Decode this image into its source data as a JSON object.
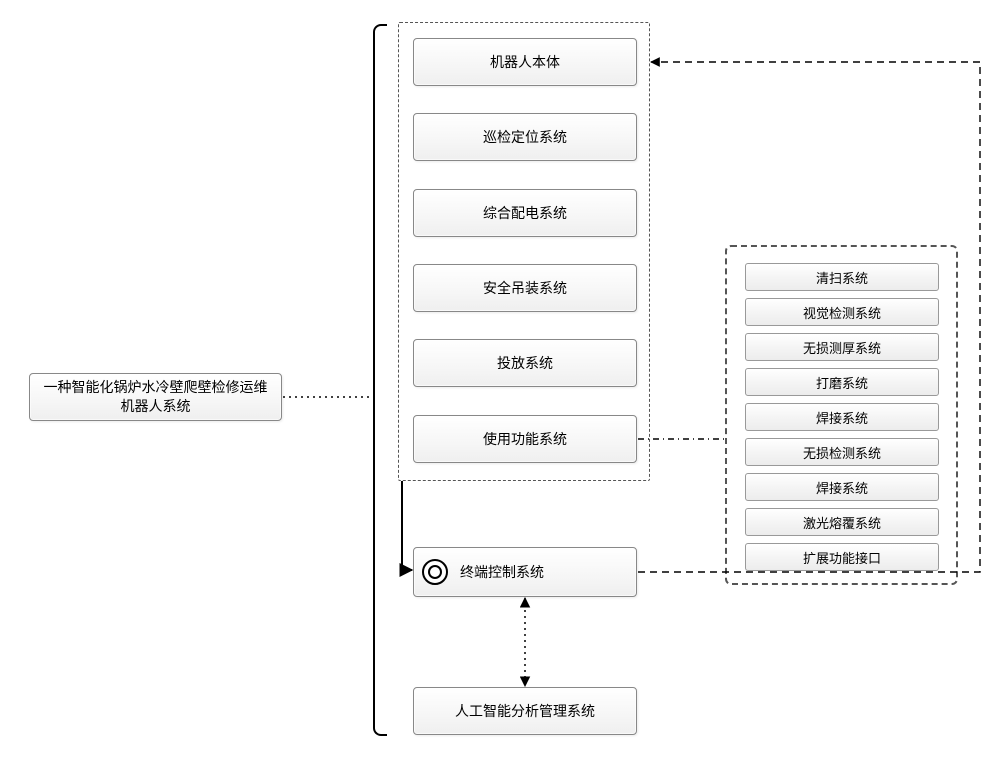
{
  "root": {
    "title": "一种智能化锅炉水冷壁爬壁检修运维\n机器人系统"
  },
  "center_group": [
    "机器人本体",
    "巡检定位系统",
    "综合配电系统",
    "安全吊装系统",
    "投放系统",
    "使用功能系统"
  ],
  "terminal": "终端控制系统",
  "ai": "人工智能分析管理系统",
  "functions": [
    "清扫系统",
    "视觉检测系统",
    "无损测厚系统",
    "打磨系统",
    "焊接系统",
    "无损检测系统",
    "焊接系统",
    "激光熔覆系统",
    "扩展功能接口"
  ]
}
